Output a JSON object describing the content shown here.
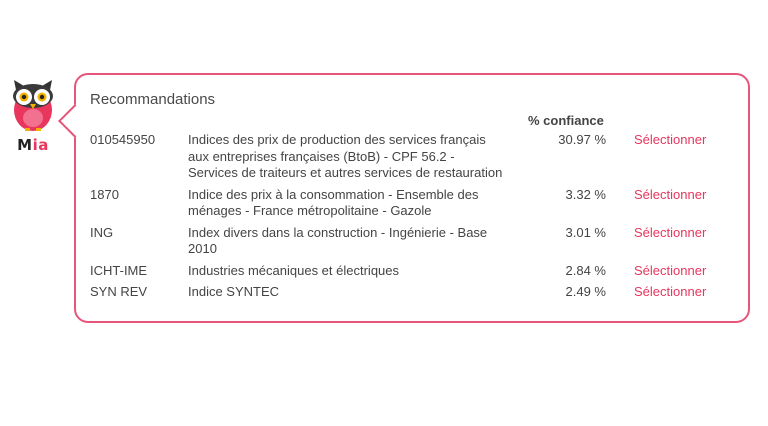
{
  "brand": {
    "prefix": "M",
    "accent": "ia"
  },
  "card": {
    "title": "Recommandations",
    "confidence_header": "% confiance"
  },
  "rows": [
    {
      "code": "010545950",
      "label": "Indices des prix de production des services français aux entreprises françaises (BtoB) - CPF 56.2 - Services de traiteurs et autres services de restauration",
      "confidence": "30.97 %",
      "action": "Sélectionner"
    },
    {
      "code": "1870",
      "label": "Indice des prix à la consommation - Ensemble des ménages - France métropolitaine - Gazole",
      "confidence": "3.32 %",
      "action": "Sélectionner"
    },
    {
      "code": "ING",
      "label": "Index divers dans la construction - Ingénierie - Base 2010",
      "confidence": "3.01 %",
      "action": "Sélectionner"
    },
    {
      "code": "ICHT-IME",
      "label": "Industries mécaniques et électriques",
      "confidence": "2.84 %",
      "action": "Sélectionner"
    },
    {
      "code": "SYN REV",
      "label": "Indice SYNTEC",
      "confidence": "2.49 %",
      "action": "Sélectionner"
    }
  ],
  "colors": {
    "accent": "#e8365d",
    "border": "#e8557a",
    "text": "#444444"
  },
  "icons": {
    "mascot": "owl-icon"
  }
}
